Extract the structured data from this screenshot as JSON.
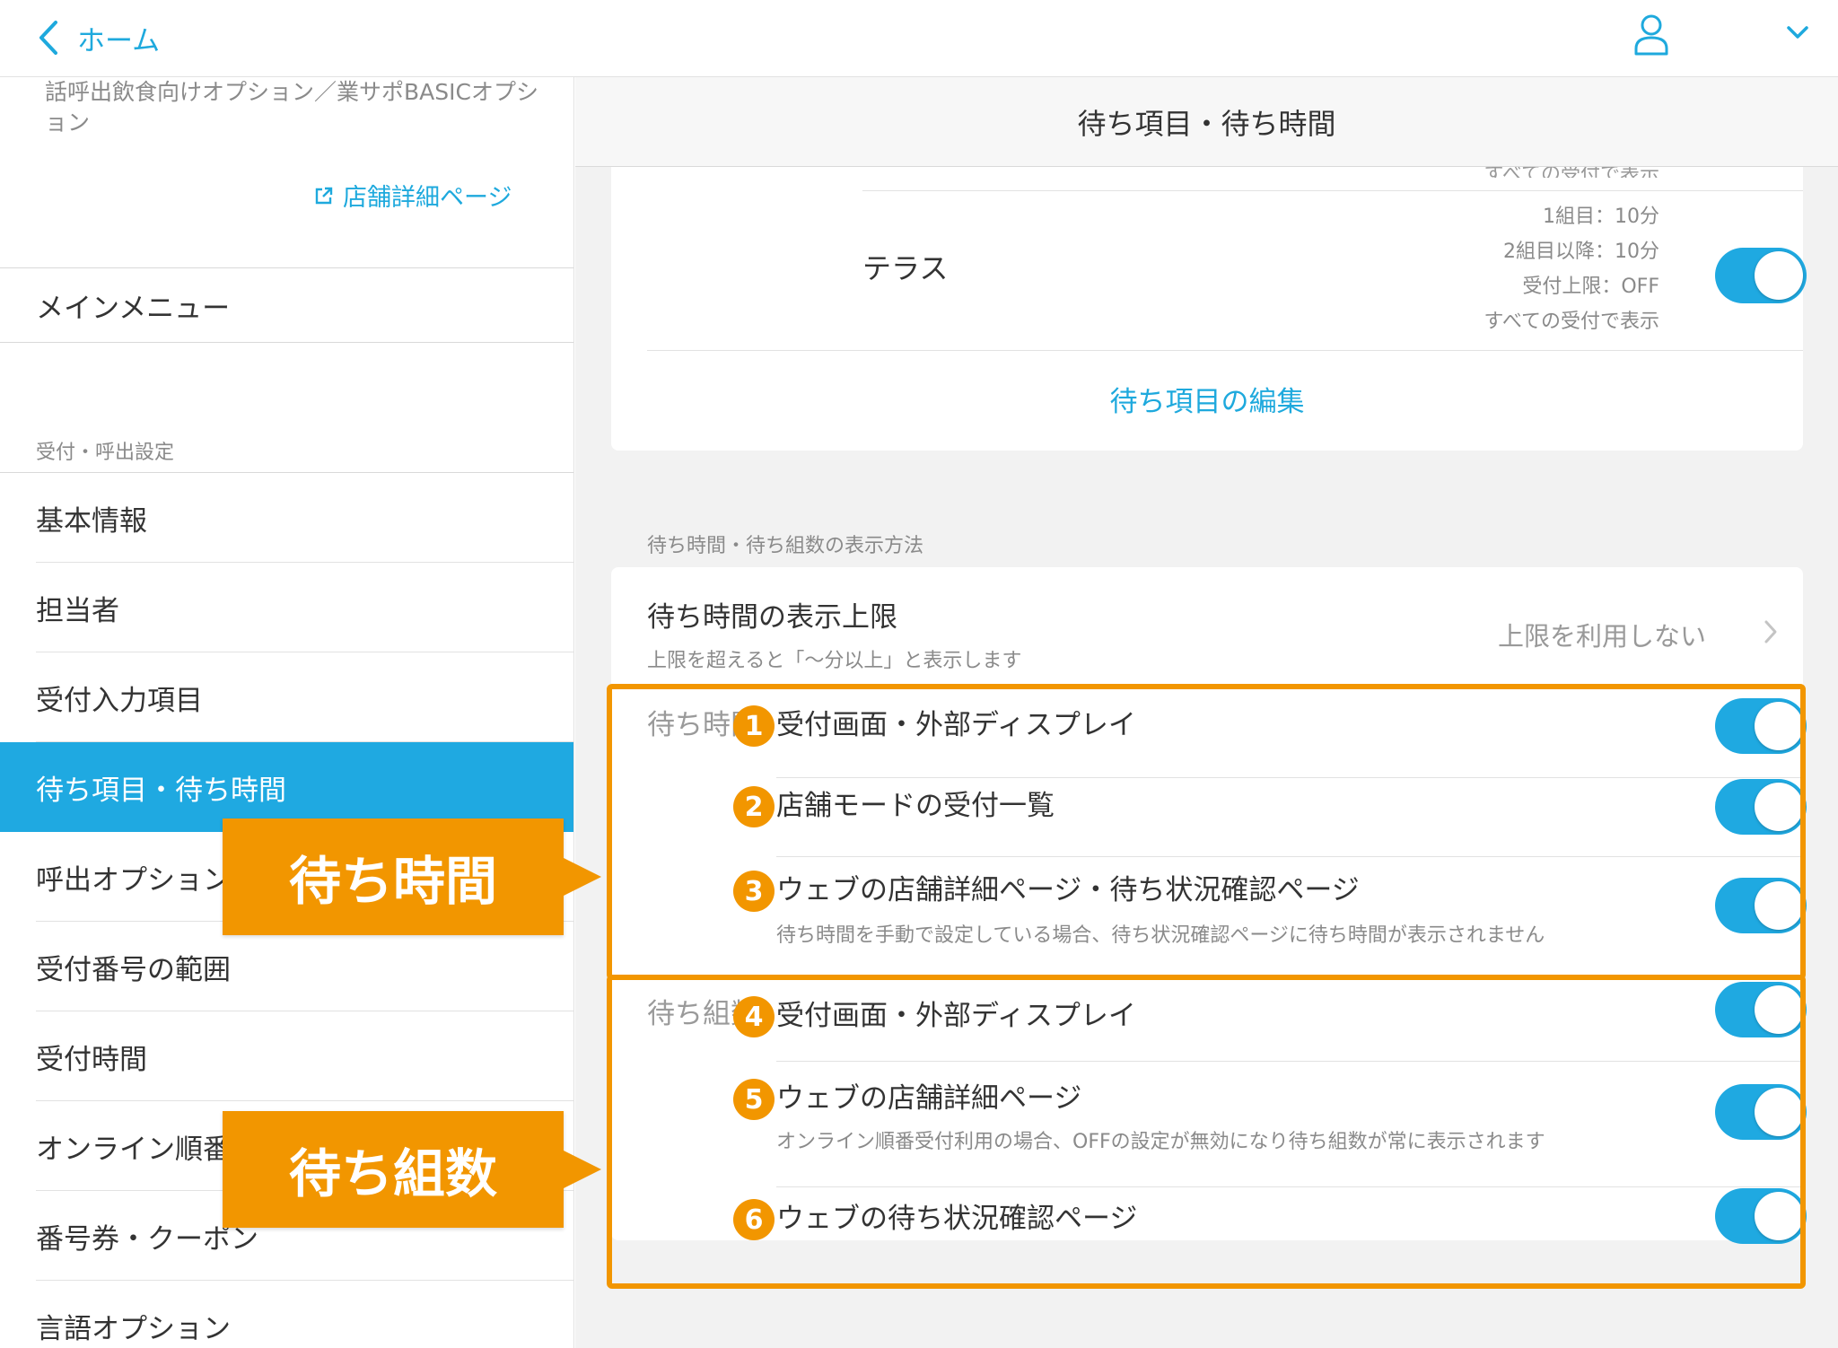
{
  "topbar": {
    "back_label": "ホーム",
    "icons": [
      "chevron-left-icon",
      "user-icon",
      "chevron-down-icon"
    ]
  },
  "sidebar": {
    "plan_text": "話呼出飲食向けオプション／業サポBASICオプション",
    "store_link": "店舗詳細ページ",
    "main_menu": "メインメニュー",
    "section_label": "受付・呼出設定",
    "items": [
      {
        "label": "基本情報"
      },
      {
        "label": "担当者"
      },
      {
        "label": "受付入力項目"
      },
      {
        "label": "待ち項目・待ち時間"
      },
      {
        "label": "呼出オプション"
      },
      {
        "label": "受付番号の範囲"
      },
      {
        "label": "受付時間"
      },
      {
        "label": "オンライン順番受付"
      },
      {
        "label": "番号券・クーポン"
      },
      {
        "label": "言語オプション"
      }
    ],
    "active_index": 3
  },
  "main": {
    "title": "待ち項目・待ち時間",
    "wait_items": {
      "clipped_text": "すべての受付で表示",
      "terrace": {
        "name": "テラス",
        "info_first": "1組目：10分",
        "info_after": "2組目以降：10分",
        "info_limit": "受付上限：OFF",
        "info_scope": "すべての受付で表示",
        "enabled": true
      },
      "edit_link": "待ち項目の編集"
    },
    "display_section_label": "待ち時間・待ち組数の表示方法",
    "limit": {
      "title": "待ち時間の表示上限",
      "subtitle": "上限を超えると「〜分以上」と表示します",
      "value": "上限を利用しない"
    },
    "wait_time_group": {
      "label": "待ち時間",
      "rows": [
        {
          "num": "1",
          "title": "受付画面・外部ディスプレイ",
          "enabled": true
        },
        {
          "num": "2",
          "title": "店舗モードの受付一覧",
          "enabled": true
        },
        {
          "num": "3",
          "title": "ウェブの店舗詳細ページ・待ち状況確認ページ",
          "subtitle": "待ち時間を手動で設定している場合、待ち状況確認ページに待ち時間が表示されません",
          "enabled": true
        }
      ]
    },
    "wait_count_group": {
      "label": "待ち組数",
      "rows": [
        {
          "num": "4",
          "title": "受付画面・外部ディスプレイ",
          "enabled": true
        },
        {
          "num": "5",
          "title": "ウェブの店舗詳細ページ",
          "subtitle": "オンライン順番受付利用の場合、OFFの設定が無効になり待ち組数が常に表示されます",
          "enabled": true
        },
        {
          "num": "6",
          "title": "ウェブの待ち状況確認ページ",
          "enabled": true
        }
      ]
    }
  },
  "annotations": {
    "callout_wait_time": "待ち時間",
    "callout_wait_count": "待ち組数",
    "accent_color": "#f29600"
  },
  "colors": {
    "primary": "#1fa9e1",
    "link": "#1ea9dd",
    "annotation": "#f29600"
  }
}
